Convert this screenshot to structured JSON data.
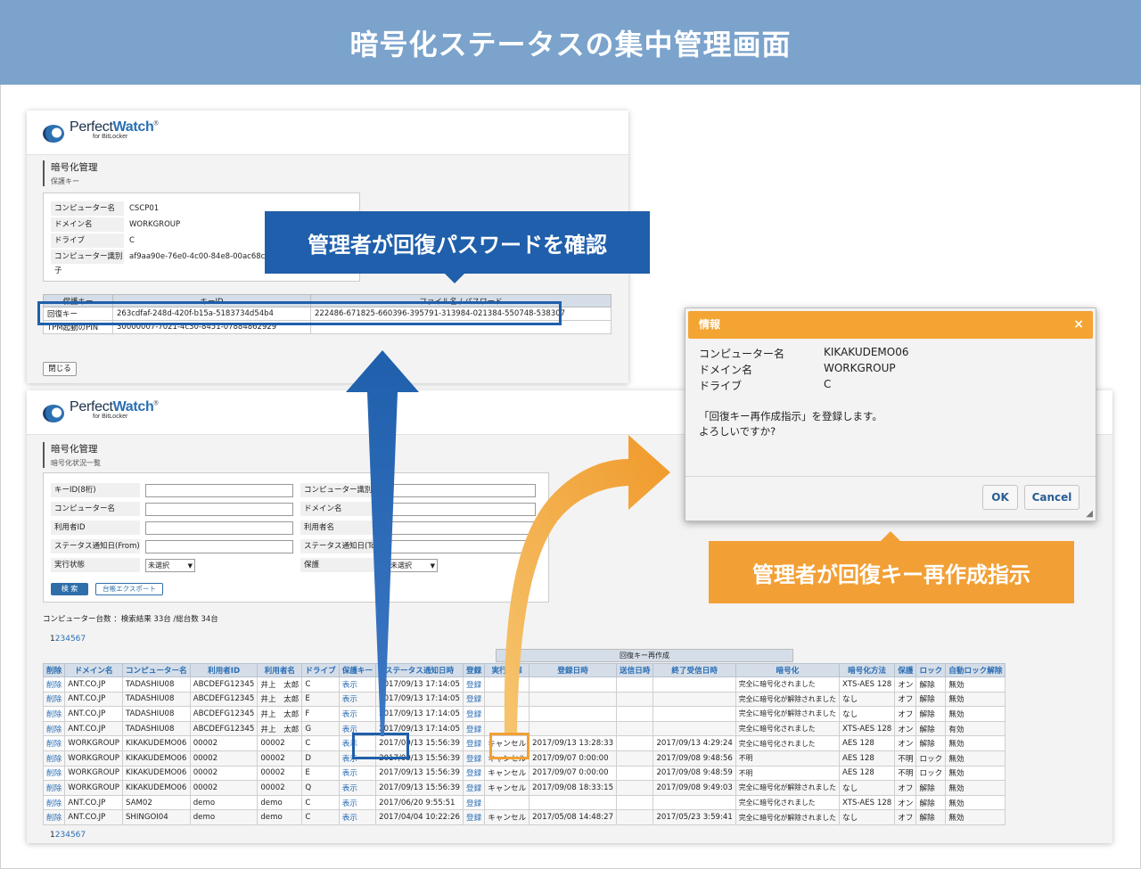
{
  "banner_title": "暗号化ステータスの集中管理画面",
  "logo": {
    "brand_a": "Perfect",
    "brand_b": "Watch",
    "reg": "®",
    "sub": "for BitLocker"
  },
  "upper": {
    "section_title": "暗号化管理",
    "section_sub": "保護キー",
    "info": [
      {
        "label": "コンピューター名",
        "value": "CSCP01"
      },
      {
        "label": "ドメイン名",
        "value": "WORKGROUP"
      },
      {
        "label": "ドライブ",
        "value": "C"
      },
      {
        "label": "コンピューター識別子",
        "value": "af9aa90e-76e0-4c00-84e8-00ac68c4a27a"
      }
    ],
    "table_headers": [
      "保護キー",
      "キーID",
      "ファイル名 / パスワード"
    ],
    "rows": [
      [
        "回復キー",
        "263cdfaf-248d-420f-b15a-5183734d54b4",
        "222486-671825-660396-395791-313984-021384-550748-538307"
      ],
      [
        "TPM起動のPIN",
        "30000007-7021-4c30-8451-07884862929",
        ""
      ]
    ],
    "close_label": "閉じる"
  },
  "lower": {
    "section_title": "暗号化管理",
    "section_sub": "暗号化状況一覧",
    "form_left": [
      "キーID(8桁)",
      "コンピューター名",
      "利用者ID",
      "ステータス通知日(From)",
      "実行状態"
    ],
    "form_right": [
      "コンピューター識別子",
      "ドメイン名",
      "利用者名",
      "ステータス通知日(To)",
      "保護"
    ],
    "select_value": "未選択",
    "search_label": "検 索",
    "export_label": "台帳エクスポート",
    "count_text": "コンピューター台数 ：検索結果 33台 /総台数 34台",
    "pager": [
      "1",
      "2",
      "3",
      "4",
      "5",
      "6",
      "7"
    ],
    "group_header": "回復キー再作成",
    "headers": [
      "削除",
      "ドメイン名",
      "コンピューター名",
      "利用者ID",
      "利用者名",
      "ドライブ",
      "保護キー",
      "ステータス通知日時",
      "登録",
      "実行状態",
      "登録日時",
      "送信日時",
      "終了受信日時",
      "暗号化",
      "暗号化方法",
      "保護",
      "ロック",
      "自動ロック解除"
    ],
    "rows": [
      [
        "削除",
        "ANT.CO.JP",
        "TADASHIU08",
        "ABCDEFG12345",
        "井上　太郎",
        "C",
        "表示",
        "2017/09/13 17:14:05",
        "登録",
        "",
        "",
        "",
        "",
        "完全に暗号化されました",
        "XTS-AES 128",
        "オン",
        "解除",
        "無効"
      ],
      [
        "削除",
        "ANT.CO.JP",
        "TADASHIU08",
        "ABCDEFG12345",
        "井上　太郎",
        "E",
        "表示",
        "2017/09/13 17:14:05",
        "登録",
        "",
        "",
        "",
        "",
        "完全に暗号化が解除されました",
        "なし",
        "オフ",
        "解除",
        "無効"
      ],
      [
        "削除",
        "ANT.CO.JP",
        "TADASHIU08",
        "ABCDEFG12345",
        "井上　太郎",
        "F",
        "表示",
        "2017/09/13 17:14:05",
        "登録",
        "",
        "",
        "",
        "",
        "完全に暗号化が解除されました",
        "なし",
        "オフ",
        "解除",
        "無効"
      ],
      [
        "削除",
        "ANT.CO.JP",
        "TADASHIU08",
        "ABCDEFG12345",
        "井上　太郎",
        "G",
        "表示",
        "2017/09/13 17:14:05",
        "登録",
        "",
        "",
        "",
        "",
        "完全に暗号化されました",
        "XTS-AES 128",
        "オン",
        "解除",
        "有効"
      ],
      [
        "削除",
        "WORKGROUP",
        "KIKAKUDEMO06",
        "00002",
        "00002",
        "C",
        "表示",
        "2017/09/13 15:56:39",
        "登録",
        "キャンセル",
        "2017/09/13 13:28:33",
        "",
        "2017/09/13 4:29:24",
        "完全に暗号化されました",
        "AES 128",
        "オン",
        "解除",
        "無効"
      ],
      [
        "削除",
        "WORKGROUP",
        "KIKAKUDEMO06",
        "00002",
        "00002",
        "D",
        "表示",
        "2017/09/13 15:56:39",
        "登録",
        "キャンセル",
        "2017/09/07 0:00:00",
        "",
        "2017/09/08 9:48:56",
        "不明",
        "AES 128",
        "不明",
        "ロック",
        "無効"
      ],
      [
        "削除",
        "WORKGROUP",
        "KIKAKUDEMO06",
        "00002",
        "00002",
        "E",
        "表示",
        "2017/09/13 15:56:39",
        "登録",
        "キャンセル",
        "2017/09/07 0:00:00",
        "",
        "2017/09/08 9:48:59",
        "不明",
        "AES 128",
        "不明",
        "ロック",
        "無効"
      ],
      [
        "削除",
        "WORKGROUP",
        "KIKAKUDEMO06",
        "00002",
        "00002",
        "Q",
        "表示",
        "2017/09/13 15:56:39",
        "登録",
        "キャンセル",
        "2017/09/08 18:33:15",
        "",
        "2017/09/08 9:49:03",
        "完全に暗号化が解除されました",
        "なし",
        "オフ",
        "解除",
        "無効"
      ],
      [
        "削除",
        "ANT.CO.JP",
        "SAM02",
        "demo",
        "demo",
        "C",
        "表示",
        "2017/06/20 9:55:51",
        "登録",
        "",
        "",
        "",
        "",
        "完全に暗号化されました",
        "XTS-AES 128",
        "オン",
        "解除",
        "無効"
      ],
      [
        "削除",
        "ANT.CO.JP",
        "SHINGOI04",
        "demo",
        "demo",
        "C",
        "表示",
        "2017/04/04 10:22:26",
        "登録",
        "キャンセル",
        "2017/05/08 14:48:27",
        "",
        "2017/05/23 3:59:41",
        "完全に暗号化が解除されました",
        "なし",
        "オフ",
        "解除",
        "無効"
      ]
    ]
  },
  "dialog": {
    "title": "情報",
    "close": "×",
    "rows": [
      {
        "label": "コンピューター名",
        "value": "KIKAKUDEMO06"
      },
      {
        "label": "ドメイン名",
        "value": "WORKGROUP"
      },
      {
        "label": "ドライブ",
        "value": "C"
      }
    ],
    "message_line1": "「回復キー再作成指示」を登録します。",
    "message_line2": "よろしいですか?",
    "ok_label": "OK",
    "cancel_label": "Cancel"
  },
  "callouts": {
    "blue": "管理者が回復パスワードを確認",
    "orange": "管理者が回復キー再作成指示"
  },
  "colors": {
    "banner": "#7ba3cc",
    "blue": "#1f5fab",
    "orange": "#f2a035",
    "link": "#2a6db5"
  }
}
